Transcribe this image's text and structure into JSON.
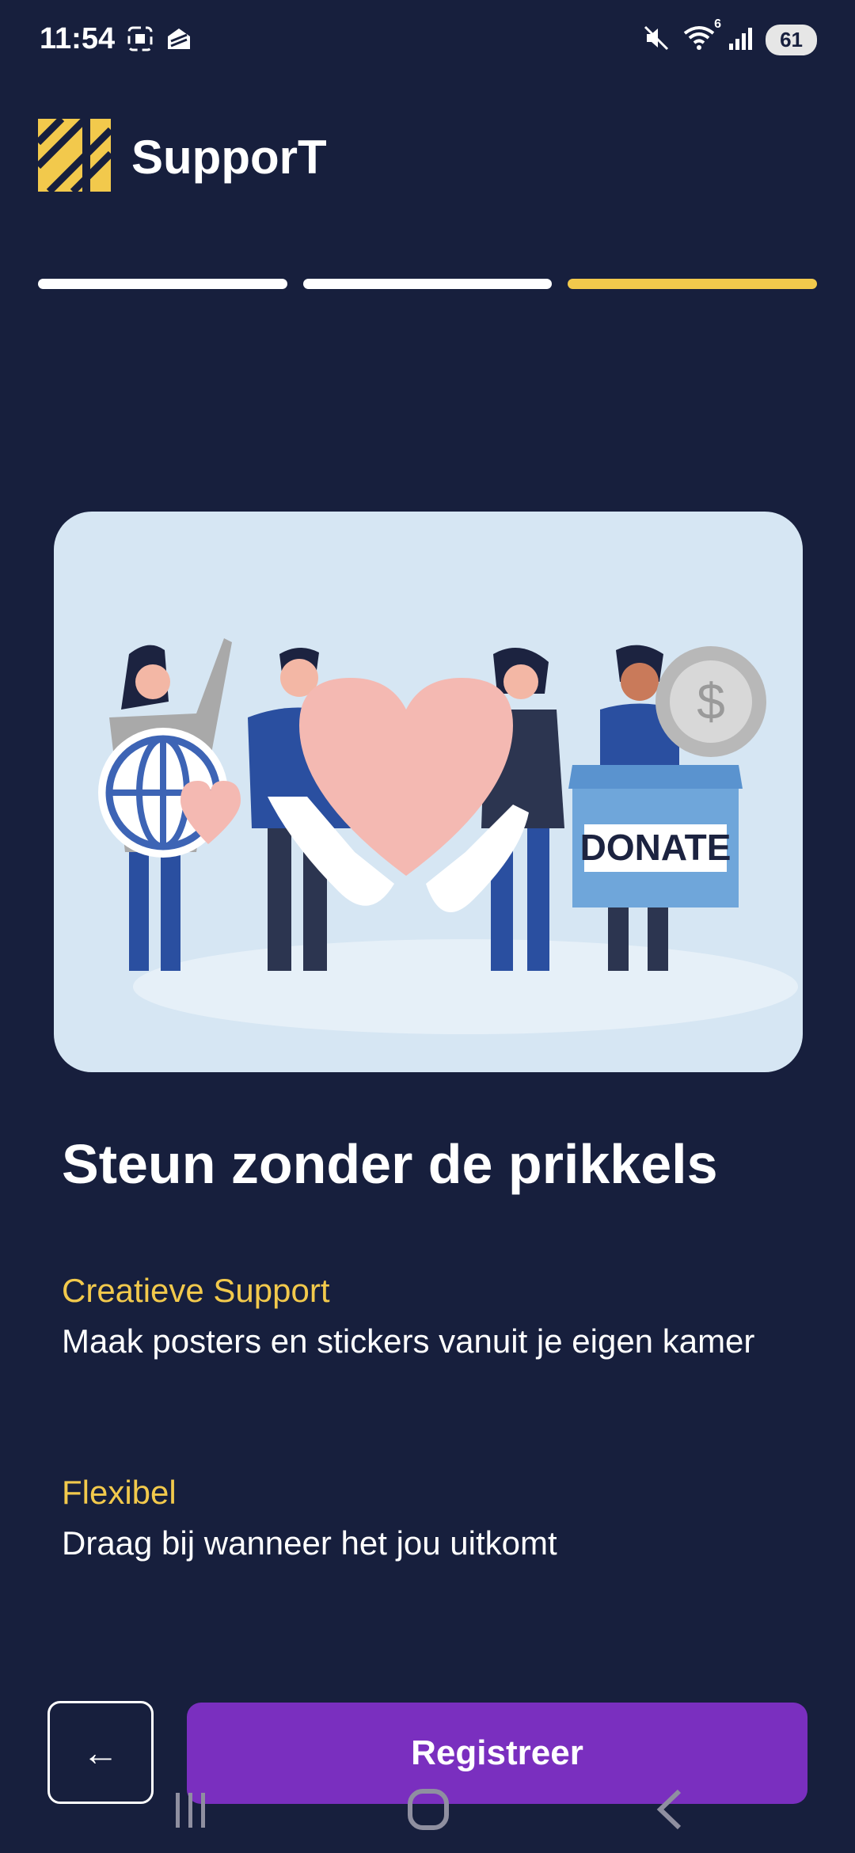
{
  "status_bar": {
    "time": "11:54",
    "battery": "61",
    "wifi_badge": "6",
    "icons": [
      "screenshot-icon",
      "app-notification-icon",
      "mute-icon",
      "wifi-icon",
      "signal-icon",
      "battery-icon"
    ]
  },
  "brand": {
    "name": "SupporT",
    "logo_color": "#f2c94c"
  },
  "progress": {
    "total_steps": 3,
    "current_step": 3,
    "active_color": "#f2c94c"
  },
  "illustration": {
    "box_label": "DONATE",
    "coin_label": "$"
  },
  "headline": "Steun zonder de prikkels",
  "features": [
    {
      "title": "Creatieve Support",
      "description": "Maak posters en stickers vanuit je eigen kamer"
    },
    {
      "title": "Flexibel",
      "description": "Draag bij wanneer het jou uitkomt"
    }
  ],
  "buttons": {
    "back_label": "←",
    "register_label": "Registreer"
  },
  "colors": {
    "background": "#171f3d",
    "accent": "#f2c94c",
    "primary": "#7a2fbf"
  }
}
